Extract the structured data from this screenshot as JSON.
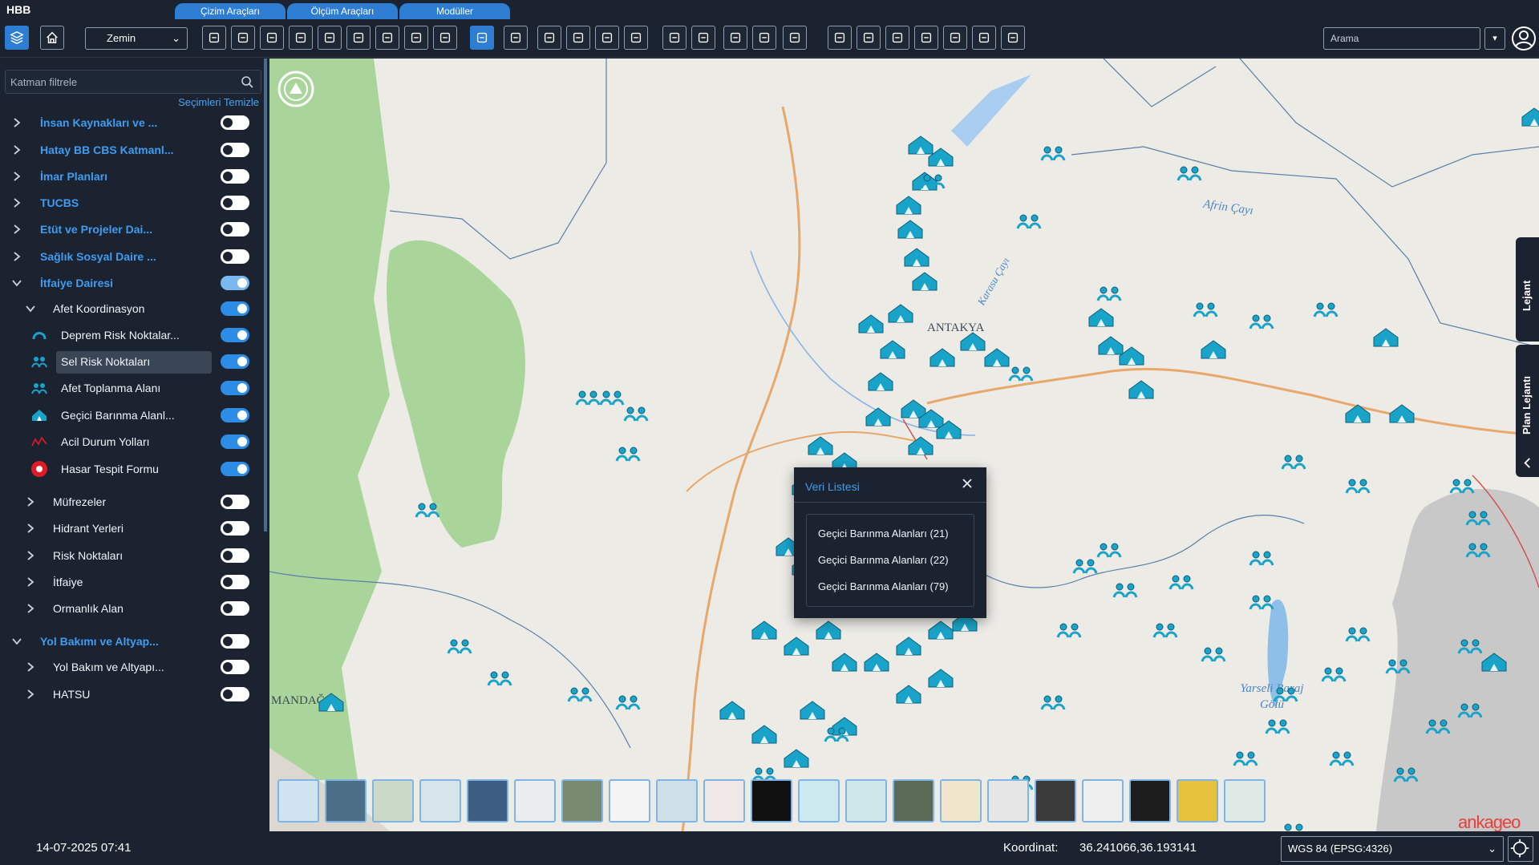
{
  "app": {
    "brand": "HBB"
  },
  "top_tabs": [
    {
      "label": "Çizim Araçları"
    },
    {
      "label": "Ölçüm Araçları"
    },
    {
      "label": "Modüller"
    }
  ],
  "toolbar": {
    "basemap_select": "Zemin",
    "search_placeholder": "Arama",
    "search_dropdown": "▾",
    "tools": [
      "layers-icon",
      "home-icon",
      "draw-line-icon",
      "draw-edit-icon",
      "trash-icon",
      "pen-icon",
      "cut-icon",
      "link-icon",
      "split-icon",
      "copy-icon",
      "polygon-icon",
      "info-icon",
      "select-icon",
      "table-icon",
      "fullscreen-icon",
      "pin-icon",
      "extent-icon",
      "xy-icon",
      "measure-line-icon",
      "measure-area-icon",
      "stamp-icon",
      "check-icon",
      "download-icon",
      "print-icon",
      "flag-icon",
      "share-icon",
      "bus-icon",
      "chart-icon",
      "clock-icon"
    ]
  },
  "sidebar": {
    "filter_placeholder": "Katman filtrele",
    "clear_selection": "Seçimleri Temizle",
    "items": [
      {
        "label": "İnsan Kaynakları ve ...",
        "level": 0,
        "expanded": false,
        "on": false
      },
      {
        "label": "Hatay BB CBS Katmanl...",
        "level": 0,
        "expanded": false,
        "on": false
      },
      {
        "label": "İmar Planları",
        "level": 0,
        "expanded": false,
        "on": false
      },
      {
        "label": "TUCBS",
        "level": 0,
        "expanded": false,
        "on": false
      },
      {
        "label": "Etüt ve Projeler Dai...",
        "level": 0,
        "expanded": false,
        "on": false
      },
      {
        "label": "Sağlık Sosyal Daire ...",
        "level": 0,
        "expanded": false,
        "on": false
      },
      {
        "label": "İtfaiye Dairesi",
        "level": 0,
        "expanded": true,
        "on": true
      },
      {
        "label": "Afet Koordinasyon",
        "level": 1,
        "expanded": true,
        "on": true
      },
      {
        "label": "Deprem Risk Noktalar...",
        "level": 2,
        "icon": "earthquake-icon",
        "on": true
      },
      {
        "label": "Sel Risk Noktaları",
        "level": 2,
        "icon": "flood-icon",
        "on": true,
        "selected": true
      },
      {
        "label": "Afet Toplanma Alanı",
        "level": 2,
        "icon": "assembly-area-icon",
        "on": true
      },
      {
        "label": "Geçici Barınma Alanl...",
        "level": 2,
        "icon": "shelter-icon",
        "on": true
      },
      {
        "label": "Acil Durum Yolları",
        "level": 2,
        "icon": "emergency-road-icon",
        "on": true
      },
      {
        "label": "Hasar Tespit Formu",
        "level": 2,
        "icon": "damage-form-icon",
        "on": true
      },
      {
        "label": "Müfrezeler",
        "level": 1,
        "expanded": false,
        "on": false
      },
      {
        "label": "Hidrant Yerleri",
        "level": 1,
        "expanded": false,
        "on": false
      },
      {
        "label": "Risk Noktaları",
        "level": 1,
        "expanded": false,
        "on": false
      },
      {
        "label": "İtfaiye",
        "level": 1,
        "expanded": false,
        "on": false
      },
      {
        "label": "Ormanlık Alan",
        "level": 1,
        "expanded": false,
        "on": false
      },
      {
        "label": "Yol Bakımı ve Altyap...",
        "level": 0,
        "expanded": true,
        "on": false
      },
      {
        "label": "Yol Bakım ve Altyapı...",
        "level": 1,
        "expanded": false,
        "on": false
      },
      {
        "label": "HATSU",
        "level": 1,
        "expanded": false,
        "on": false
      }
    ]
  },
  "map": {
    "labels": {
      "city": "ANTAKYA",
      "town": "MANDAĞ",
      "river1": "Afrin Çayı",
      "river2": "Karasu Çayı",
      "lake": "Yarseli Baraj Gölü"
    },
    "popup": {
      "title": "Veri Listesi",
      "items": [
        "Geçici Barınma Alanları (21)",
        "Geçici Barınma Alanları (22)",
        "Geçici Barınma Alanları (79)"
      ]
    },
    "right_tabs": [
      "Lejant",
      "Plan Lejantı"
    ],
    "basemaps_count": 21,
    "brandmark": "ankageo"
  },
  "status": {
    "datetime": "14-07-2025 07:41",
    "coord_label": "Koordinat:",
    "coord_value": "36.241066,36.193141",
    "crs": "WGS 84 (EPSG:4326)"
  },
  "colors": {
    "accent": "#2d7dd2",
    "panel": "#1b2330",
    "group_text": "#3f9cf0",
    "symbol": "#1aa3c8"
  }
}
